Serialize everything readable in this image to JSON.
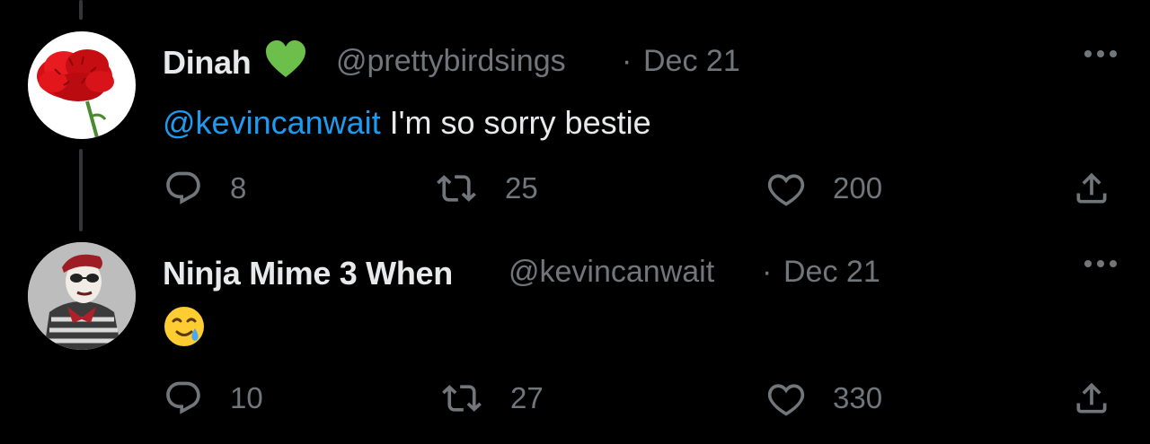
{
  "tweets": [
    {
      "name": "Dinah",
      "handle": "@prettybirdsings",
      "separator": "·",
      "date": "Dec 21",
      "mention": "@kevincanwait",
      "text": " I'm so sorry bestie",
      "badge_icon": "green-heart-icon",
      "avatar_icon": "red-carnation-icon",
      "replies": "8",
      "retweets": "25",
      "likes": "200"
    },
    {
      "name": "Ninja Mime 3 When",
      "handle": "@kevincanwait",
      "separator": "·",
      "date": "Dec 21",
      "emoji_icon": "smiling-face-with-tear-icon",
      "avatar_icon": "mime-portrait-icon",
      "replies": "10",
      "retweets": "27",
      "likes": "330"
    }
  ],
  "colors": {
    "background": "#000000",
    "primary_text": "#e7e9ea",
    "secondary_text": "#71767b",
    "mention": "#1d9bf0",
    "badge": "#6cbf4b",
    "thread_line": "#333639"
  }
}
